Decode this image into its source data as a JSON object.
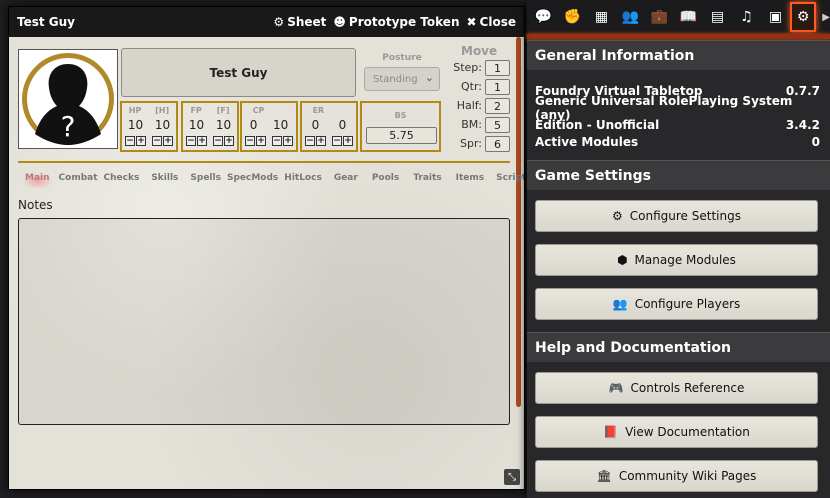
{
  "sheet": {
    "title": "Test Guy",
    "header_buttons": [
      {
        "icon": "gear-icon",
        "glyph": "⚙",
        "label": "Sheet"
      },
      {
        "icon": "user-circle-icon",
        "glyph": "☻",
        "label": "Prototype Token"
      },
      {
        "icon": "close-icon",
        "glyph": "✖",
        "label": "Close"
      }
    ],
    "name": "Test Guy",
    "posture": {
      "label": "Posture",
      "value": "Standing"
    },
    "move": {
      "title": "Move",
      "rows": [
        {
          "label": "Step:",
          "value": "1"
        },
        {
          "label": "Qtr:",
          "value": "1"
        },
        {
          "label": "Half:",
          "value": "2"
        },
        {
          "label": "BM:",
          "value": "5"
        },
        {
          "label": "Spr:",
          "value": "6"
        }
      ]
    },
    "stats": [
      {
        "labels": [
          "HP",
          "[H]"
        ],
        "values": [
          "10",
          "10"
        ]
      },
      {
        "labels": [
          "FP",
          "[F]"
        ],
        "values": [
          "10",
          "10"
        ]
      },
      {
        "labels": [
          "CP",
          ""
        ],
        "values": [
          "0",
          "10"
        ]
      },
      {
        "labels": [
          "ER",
          ""
        ],
        "values": [
          "0",
          "0"
        ]
      }
    ],
    "bs": {
      "label": "BS",
      "value": "5.75"
    },
    "tabs": [
      "Main",
      "Combat",
      "Checks",
      "Skills",
      "Spells",
      "SpecMods",
      "HitLocs",
      "Gear",
      "Pools",
      "Traits",
      "Items",
      "Scripts"
    ],
    "active_tab": "Main",
    "notes_label": "Notes"
  },
  "sidebar": {
    "tab_icons": [
      {
        "name": "chat-icon",
        "glyph": "💬"
      },
      {
        "name": "combat-fist-icon",
        "glyph": "✊"
      },
      {
        "name": "map-icon",
        "glyph": "▦"
      },
      {
        "name": "users-icon",
        "glyph": "👥"
      },
      {
        "name": "items-suitcase-icon",
        "glyph": "💼"
      },
      {
        "name": "journal-book-icon",
        "glyph": "📖"
      },
      {
        "name": "tables-icon",
        "glyph": "▤"
      },
      {
        "name": "music-icon",
        "glyph": "♫"
      },
      {
        "name": "compendium-icon",
        "glyph": "▣"
      },
      {
        "name": "settings-cogs-icon",
        "glyph": "⚙"
      }
    ],
    "general": {
      "title": "General Information",
      "rows": [
        {
          "label": "Foundry Virtual Tabletop",
          "value": "0.7.7"
        },
        {
          "label": "Generic Universal RolePlaying System (any)",
          "value": ""
        },
        {
          "label": "Edition - Unofficial",
          "value": "3.4.2"
        },
        {
          "label": "Active Modules",
          "value": "0"
        }
      ]
    },
    "game_settings": {
      "title": "Game Settings",
      "buttons": [
        {
          "icon": "cogs-icon",
          "glyph": "⚙",
          "label": "Configure Settings"
        },
        {
          "icon": "cube-icon",
          "glyph": "⬢",
          "label": "Manage Modules"
        },
        {
          "icon": "users-icon",
          "glyph": "👥",
          "label": "Configure Players"
        }
      ]
    },
    "help": {
      "title": "Help and Documentation",
      "buttons": [
        {
          "icon": "gamepad-icon",
          "glyph": "🎮",
          "label": "Controls Reference"
        },
        {
          "icon": "book-icon",
          "glyph": "📕",
          "label": "View Documentation"
        },
        {
          "icon": "university-icon",
          "glyph": "🏛",
          "label": "Community Wiki Pages"
        }
      ]
    }
  }
}
